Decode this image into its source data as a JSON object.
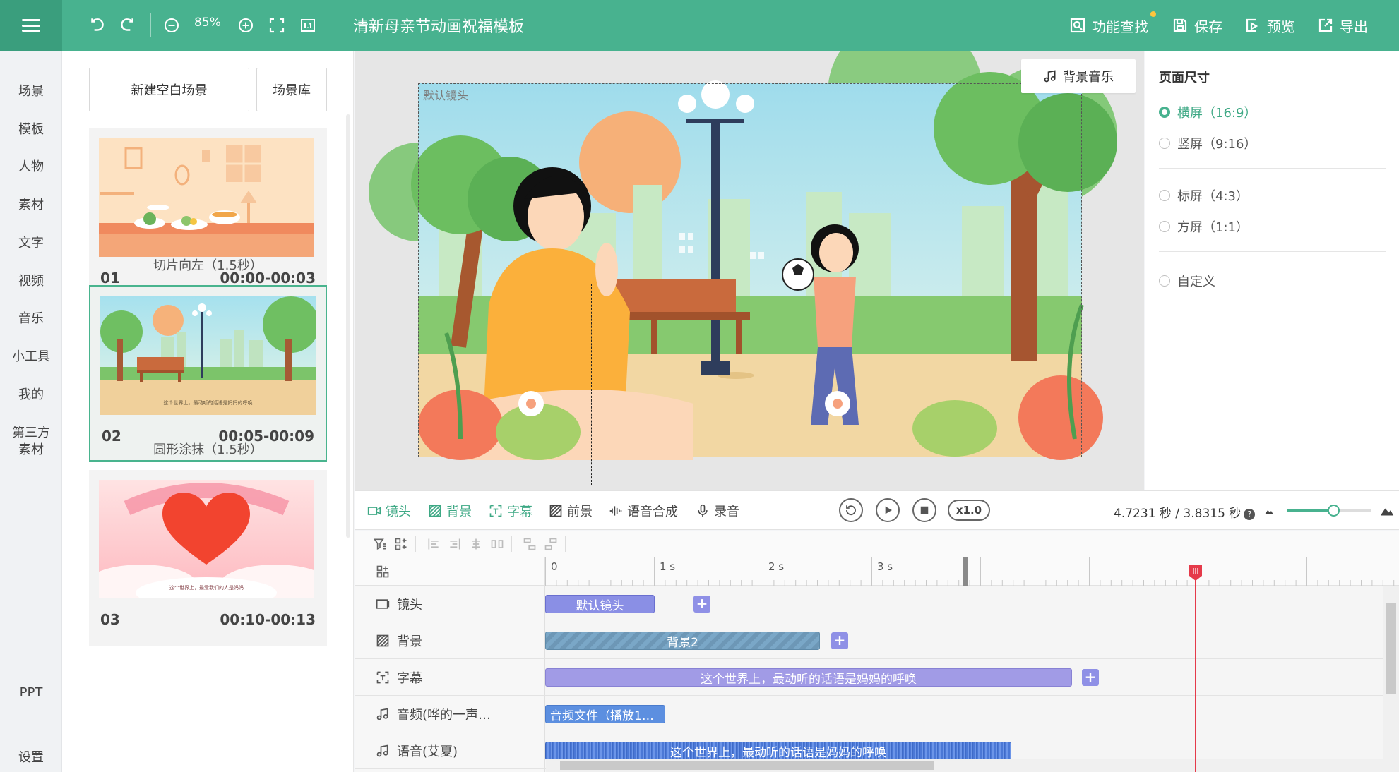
{
  "topbar": {
    "zoom": "85%",
    "title": "清新母亲节动画祝福模板",
    "find": "功能查找",
    "save": "保存",
    "preview": "预览",
    "export": "导出"
  },
  "leftnav": [
    "场景",
    "模板",
    "人物",
    "素材",
    "文字",
    "视频",
    "音乐",
    "小工具",
    "我的",
    "第三方",
    "素材"
  ],
  "leftnav_bottom": {
    "ppt": "PPT",
    "settings": "设置"
  },
  "scenes": {
    "new_blank": "新建空白场景",
    "library": "场景库",
    "items": [
      {
        "num": "01",
        "time": "00:00-00:03"
      },
      {
        "num": "02",
        "time": "00:05-00:09"
      },
      {
        "num": "03",
        "time": "00:10-00:13"
      }
    ],
    "transitions": [
      "切片向左（1.5秒）",
      "圆形涂抹（1.5秒）"
    ],
    "thumb2_caption": "这个世界上，最动听的话语是妈妈的呼唤",
    "thumb3_caption": "这个世界上，最爱我们的人是妈妈"
  },
  "canvas": {
    "bgm": "背景音乐",
    "camera_label": "默认镜头"
  },
  "props": {
    "title": "页面尺寸",
    "options": [
      {
        "label": "横屏（16:9）",
        "selected": true
      },
      {
        "label": "竖屏（9:16）",
        "selected": false
      },
      {
        "label": "标屏（4:3）",
        "selected": false
      },
      {
        "label": "方屏（1:1）",
        "selected": false
      },
      {
        "label": "自定义",
        "selected": false
      }
    ]
  },
  "timeline": {
    "tabs": [
      "镜头",
      "背景",
      "字幕",
      "前景",
      "语音合成",
      "录音"
    ],
    "speed": "x1.0",
    "time": "4.7231 秒 / 3.8315 秒",
    "zoom_fraction": 0.55,
    "ruler": [
      "0",
      "1 s",
      "2 s",
      "3 s"
    ],
    "tracks": [
      {
        "label": "镜头",
        "clip": "默认镜头"
      },
      {
        "label": "背景",
        "clip": "背景2"
      },
      {
        "label": "字幕",
        "clip": "这个世界上，最动听的话语是妈妈的呼唤"
      },
      {
        "label": "音频(哗的一声…",
        "clip": "音频文件（播放1…"
      },
      {
        "label": "语音(艾夏)",
        "clip": "这个世界上，最动听的话语是妈妈的呼唤"
      }
    ]
  },
  "colors": {
    "brand": "#48b28f",
    "camera_clip": "#8a8fe5",
    "bg_clip": "#7aa7c7",
    "subtitle_clip": "#a19be6",
    "audio_clip": "#5c8fe0",
    "playhead": "#e53a4a"
  }
}
